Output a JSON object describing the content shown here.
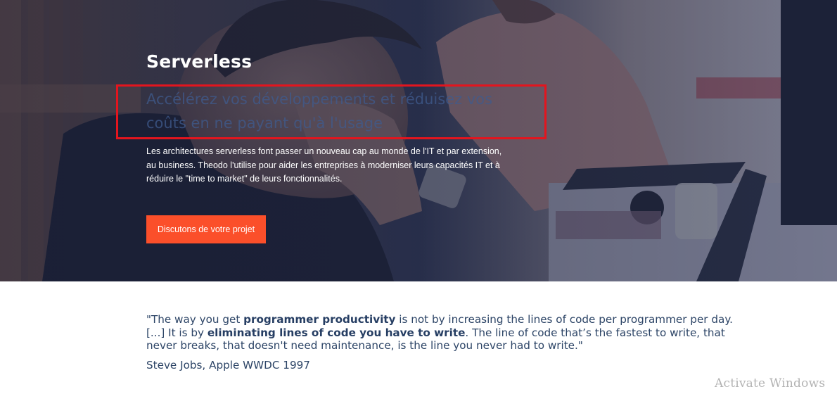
{
  "hero": {
    "title": "Serverless",
    "subtitle": "Accélérez vos développements et réduisez vos coûts en ne payant qu'à l'usage",
    "body": "Les architectures serverless font passer un nouveau cap au monde de l'IT et par extension, au business. Theodo l'utilise pour aider les entreprises à moderniser leurs capacités IT et à réduire le \"time to market\" de leurs fonctionnalités.",
    "cta_label": "Discutons de votre projet"
  },
  "quote": {
    "open": "\"The way you get ",
    "bold_1": "programmer productivity",
    "mid_1": " is not by increasing the lines of code per programmer per day. [...] It is by ",
    "bold_2": "eliminating lines of code you have to write",
    "end": ". The line of code that’s the fastest to write, that never breaks, that doesn't need maintenance, is the line you never had to write.\"",
    "author": "Steve Jobs, Apple WWDC 1997"
  },
  "system": {
    "watermark": "Activate Windows"
  },
  "colors": {
    "accent": "#fb4f2a",
    "annotation": "#e3151e",
    "quote_text": "#2c4466"
  }
}
